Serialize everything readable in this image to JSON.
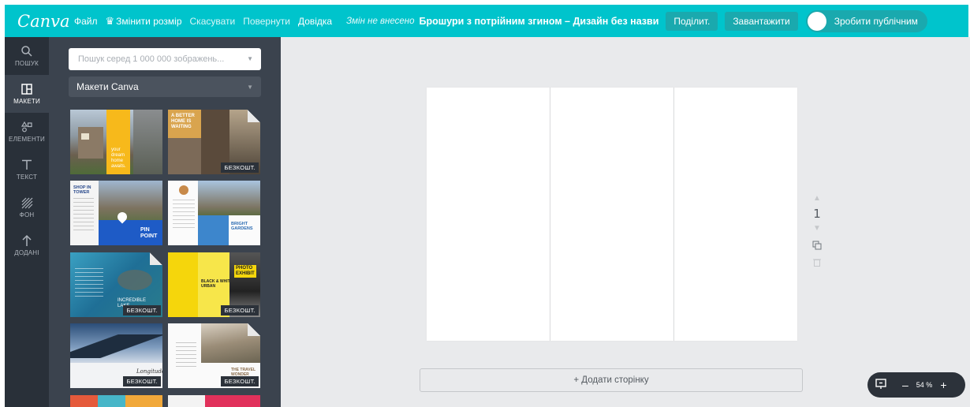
{
  "topbar": {
    "logo": "Canva",
    "file": "Файл",
    "resize": "Змінити розмір",
    "undo": "Скасувати",
    "redo": "Повернути",
    "help": "Довідка",
    "status": "Змін не внесено",
    "doc_title": "Брошури з потрійним згином – Дизайн без назви",
    "share": "Поділит.",
    "download": "Завантажити",
    "publish": "Зробити публічним",
    "accent_color": "#00c4cc"
  },
  "rail": {
    "items": [
      {
        "label": "ПОШУК",
        "icon": "search-icon"
      },
      {
        "label": "МАКЕТИ",
        "icon": "layouts-icon"
      },
      {
        "label": "ЕЛЕМЕНТИ",
        "icon": "elements-icon"
      },
      {
        "label": "ТЕКСТ",
        "icon": "text-icon"
      },
      {
        "label": "ФОН",
        "icon": "background-icon"
      },
      {
        "label": "ДОДАНІ",
        "icon": "upload-icon"
      }
    ]
  },
  "panel": {
    "search_placeholder": "Пошук серед 1 000 000 зображень...",
    "layout_select": "Макети Canva",
    "free_badge": "БЕЗКОШТ."
  },
  "thumbs": {
    "t1": {
      "line1": "your",
      "line2": "dream",
      "line3": "home",
      "line4": "awaits."
    },
    "t2": {
      "line1": "A BETTER",
      "line2": "HOME IS",
      "line3": "WAITING"
    },
    "t3": {
      "line1": "SHOP IN",
      "line2": "TOWER",
      "brand1": "PIN",
      "brand2": "POINT"
    },
    "t4": {
      "line1": "BRIGHT",
      "line2": "GARDENS"
    },
    "t5": {
      "line1": "INCREDIBLE",
      "line2": "LAKE"
    },
    "t6": {
      "line1": "PHOTO",
      "line2": "EXHIBIT",
      "line3": "BLACK & WHITE",
      "line4": "URBAN"
    },
    "t7": {
      "line1": "Longitude"
    },
    "t8": {
      "line1": "THE TRAVEL",
      "line2": "WONDER"
    }
  },
  "editor": {
    "page_number": "1",
    "add_page": "+ Додати сторінку",
    "zoom": "54 %",
    "zoom_minus": "–",
    "zoom_plus": "+"
  }
}
